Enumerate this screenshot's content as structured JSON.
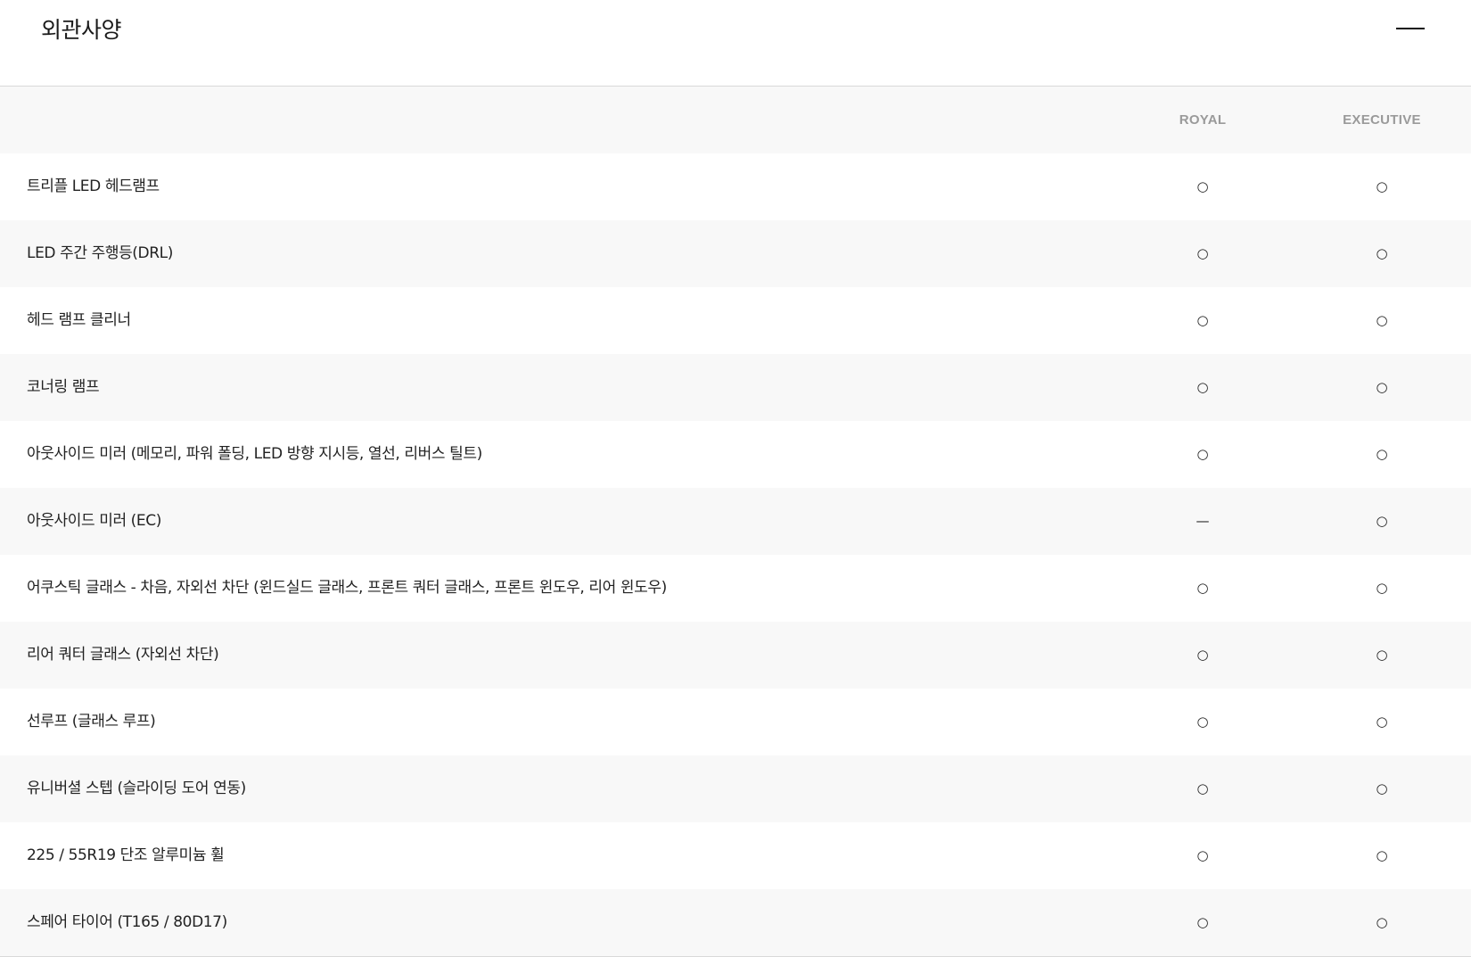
{
  "section": {
    "title": "외관사양"
  },
  "table": {
    "columns": [
      "ROYAL",
      "EXECUTIVE"
    ],
    "rows": [
      {
        "label": "트리플 LED 헤드램프",
        "royal": "○",
        "executive": "○"
      },
      {
        "label": "LED 주간 주행등(DRL)",
        "royal": "○",
        "executive": "○"
      },
      {
        "label": "헤드 램프 클리너",
        "royal": "○",
        "executive": "○"
      },
      {
        "label": "코너링 램프",
        "royal": "○",
        "executive": "○"
      },
      {
        "label": "아웃사이드 미러 (메모리, 파워 폴딩, LED 방향 지시등, 열선, 리버스 틸트)",
        "royal": "○",
        "executive": "○"
      },
      {
        "label": "아웃사이드 미러 (EC)",
        "royal": "—",
        "executive": "○"
      },
      {
        "label": "어쿠스틱 글래스 - 차음, 자외선 차단 (윈드실드 글래스, 프론트 쿼터 글래스, 프론트 윈도우, 리어 윈도우)",
        "royal": "○",
        "executive": "○"
      },
      {
        "label": "리어 쿼터 글래스 (자외선 차단)",
        "royal": "○",
        "executive": "○"
      },
      {
        "label": "선루프 (글래스 루프)",
        "royal": "○",
        "executive": "○"
      },
      {
        "label": "유니버셜 스텝 (슬라이딩 도어 연동)",
        "royal": "○",
        "executive": "○"
      },
      {
        "label": "225 / 55R19 단조 알루미늄 휠",
        "royal": "○",
        "executive": "○"
      },
      {
        "label": "스페어 타이어 (T165 / 80D17)",
        "royal": "○",
        "executive": "○"
      }
    ]
  }
}
